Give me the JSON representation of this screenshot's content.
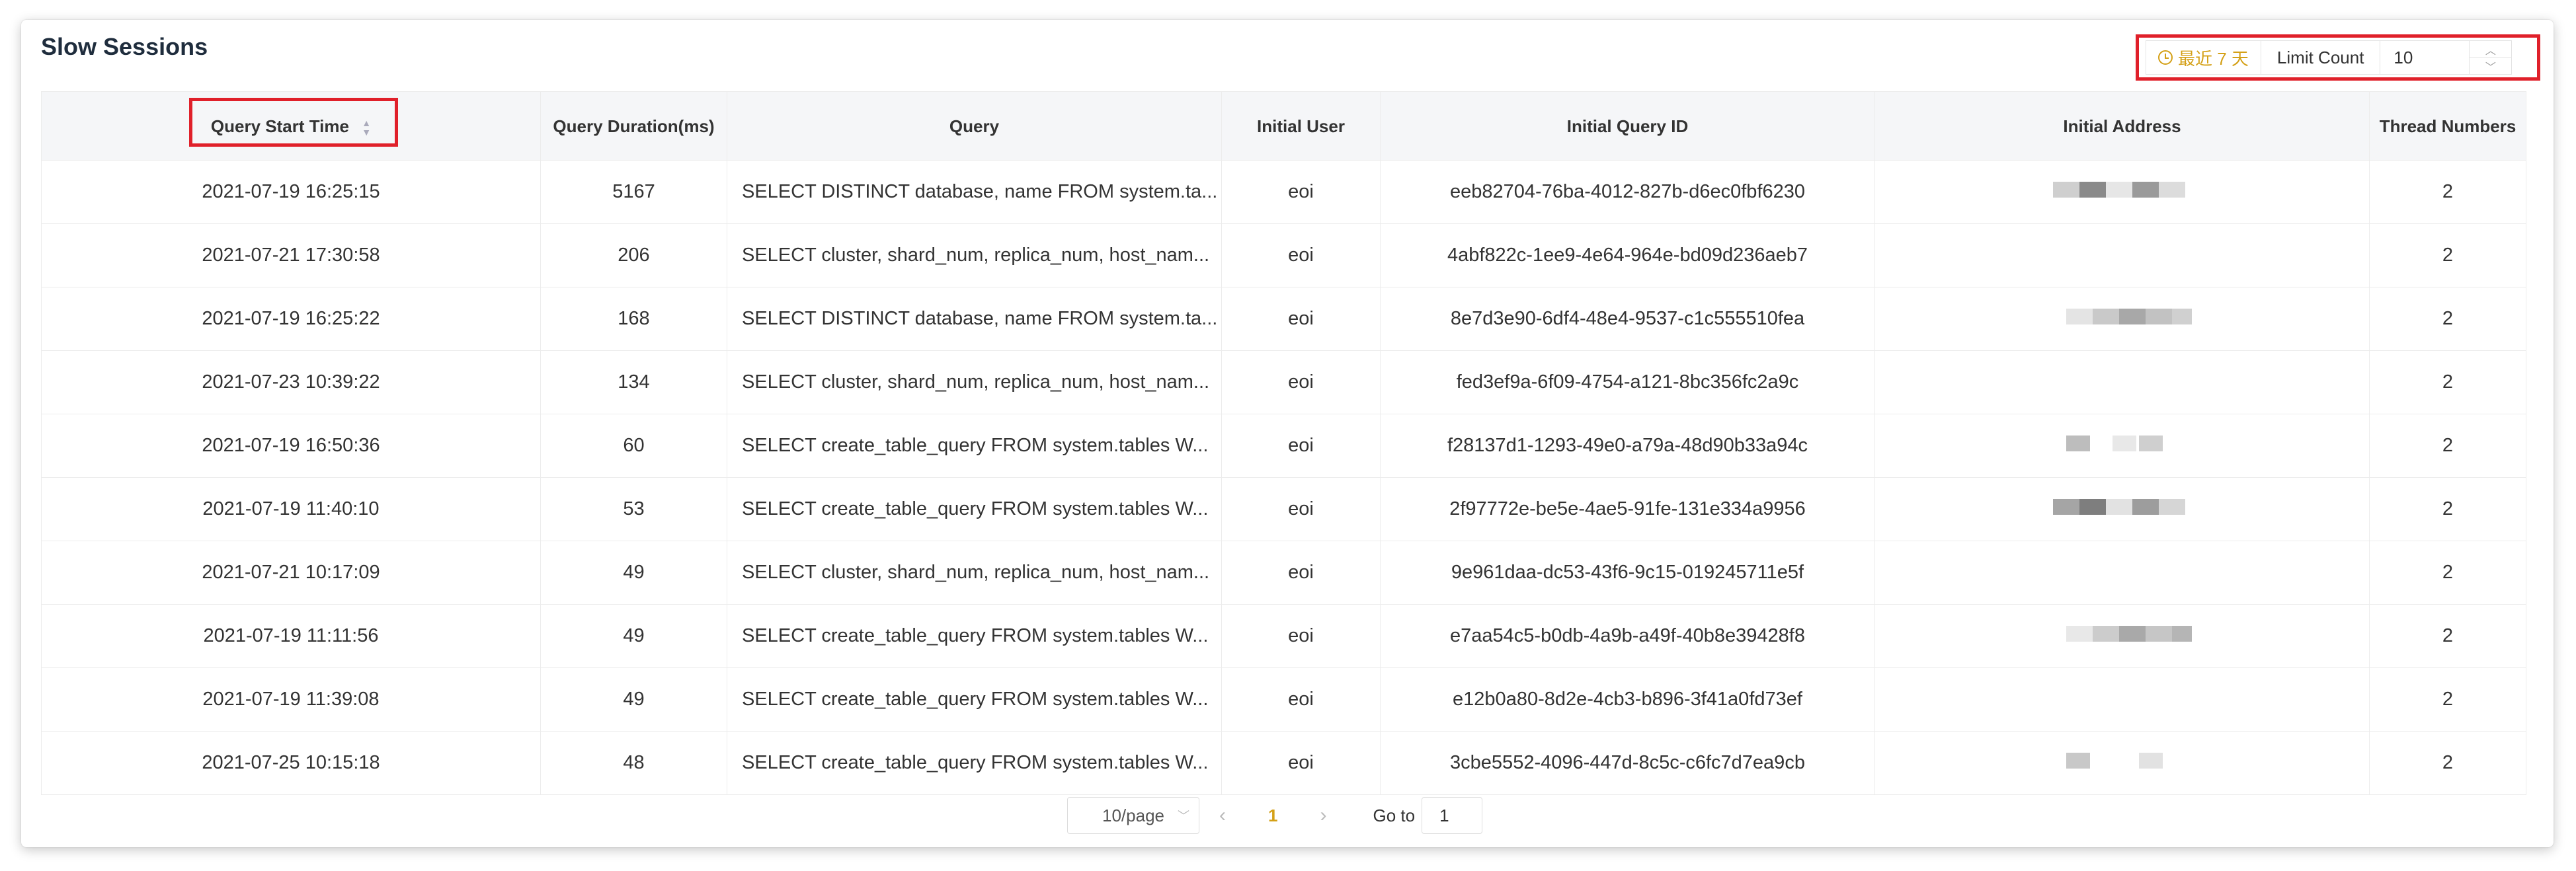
{
  "title": "Slow Sessions",
  "toolbar": {
    "range_label": "最近 7 天",
    "limit_label": "Limit Count",
    "limit_value": "10",
    "accent_color": "#d4a017"
  },
  "columns": [
    "Query Start Time",
    "Query Duration(ms)",
    "Query",
    "Initial User",
    "Initial Query ID",
    "Initial Address",
    "Thread Numbers"
  ],
  "rows": [
    {
      "time": "2021-07-19 16:25:15",
      "duration": "5167",
      "query": "SELECT DISTINCT database, name FROM system.ta...",
      "user": "eoi",
      "id": "eeb82704-76ba-4012-827b-d6ec0fbf6230",
      "threads": "2"
    },
    {
      "time": "2021-07-21 17:30:58",
      "duration": "206",
      "query": "SELECT cluster, shard_num, replica_num, host_nam...",
      "user": "eoi",
      "id": "4abf822c-1ee9-4e64-964e-bd09d236aeb7",
      "threads": "2"
    },
    {
      "time": "2021-07-19 16:25:22",
      "duration": "168",
      "query": "SELECT DISTINCT database, name FROM system.ta...",
      "user": "eoi",
      "id": "8e7d3e90-6df4-48e4-9537-c1c555510fea",
      "threads": "2"
    },
    {
      "time": "2021-07-23 10:39:22",
      "duration": "134",
      "query": "SELECT cluster, shard_num, replica_num, host_nam...",
      "user": "eoi",
      "id": "fed3ef9a-6f09-4754-a121-8bc356fc2a9c",
      "threads": "2"
    },
    {
      "time": "2021-07-19 16:50:36",
      "duration": "60",
      "query": "SELECT create_table_query FROM system.tables W...",
      "user": "eoi",
      "id": "f28137d1-1293-49e0-a79a-48d90b33a94c",
      "threads": "2"
    },
    {
      "time": "2021-07-19 11:40:10",
      "duration": "53",
      "query": "SELECT create_table_query FROM system.tables W...",
      "user": "eoi",
      "id": "2f97772e-be5e-4ae5-91fe-131e334a9956",
      "threads": "2"
    },
    {
      "time": "2021-07-21 10:17:09",
      "duration": "49",
      "query": "SELECT cluster, shard_num, replica_num, host_nam...",
      "user": "eoi",
      "id": "9e961daa-dc53-43f6-9c15-019245711e5f",
      "threads": "2"
    },
    {
      "time": "2021-07-19 11:11:56",
      "duration": "49",
      "query": "SELECT create_table_query FROM system.tables W...",
      "user": "eoi",
      "id": "e7aa54c5-b0db-4a9b-a49f-40b8e39428f8",
      "threads": "2"
    },
    {
      "time": "2021-07-19 11:39:08",
      "duration": "49",
      "query": "SELECT create_table_query FROM system.tables W...",
      "user": "eoi",
      "id": "e12b0a80-8d2e-4cb3-b896-3f41a0fd73ef",
      "threads": "2"
    },
    {
      "time": "2021-07-25 10:15:18",
      "duration": "48",
      "query": "SELECT create_table_query FROM system.tables W...",
      "user": "eoi",
      "id": "3cbe5552-4096-447d-8c5c-c6fc7d7ea9cb",
      "threads": "2"
    }
  ],
  "pagination": {
    "page_size": "10/page",
    "current_page": "1",
    "goto_label": "Go to",
    "goto_value": "1"
  }
}
